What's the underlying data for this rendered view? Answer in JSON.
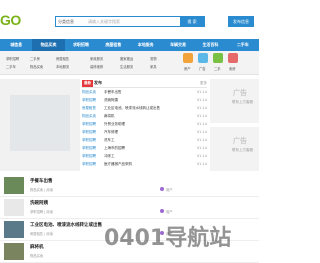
{
  "header": {
    "logo_text": "GO",
    "search": {
      "category": "分类信息",
      "placeholder": "请输入关键字搜索",
      "button": "搜 索"
    },
    "post_button": "发布信息"
  },
  "nav": [
    "城信息",
    "物品买卖",
    "求职招聘",
    "房屋租售",
    "本地服务",
    "车辆交易",
    "生活百科",
    "二手车"
  ],
  "categories": {
    "group1": [
      "求职招聘",
      "二手车",
      "二手房"
    ],
    "group2": [
      "物品买卖",
      "房屋租售",
      "本地服务"
    ],
    "group3": [
      "家政服务",
      "装修维修",
      "搬家搬运"
    ],
    "group4": [
      "生活服务",
      "宠物",
      "家具"
    ],
    "icon_labels": [
      "房产",
      "广告",
      "二手",
      "卖房"
    ]
  },
  "latest": {
    "tag_new": "最新",
    "tag_pub": "发布",
    "more": "更多",
    "rows": [
      {
        "cat": "物品买卖",
        "title": "手餐车出售",
        "date": "01-14"
      },
      {
        "cat": "求职招聘",
        "title": "洗碗阿姨",
        "date": "01-14"
      },
      {
        "cat": "房屋租售",
        "title": "工业区电池、喷漆流水线转让或出售",
        "date": "01-14"
      },
      {
        "cat": "物品买卖",
        "title": "麻将机",
        "date": "01-14"
      },
      {
        "cat": "求职招聘",
        "title": "外贸业务助理",
        "date": "01-14"
      },
      {
        "cat": "求职招聘",
        "title": "汽车修理",
        "date": "01-14"
      },
      {
        "cat": "求职招聘",
        "title": "洗车工",
        "date": "01-14"
      },
      {
        "cat": "求职招聘",
        "title": "上海市的招聘",
        "date": "01-14"
      },
      {
        "cat": "求职招聘",
        "title": "冲床工",
        "date": "01-14"
      },
      {
        "cat": "求职招聘",
        "title": "医疗器械产品采购",
        "date": "01-14"
      }
    ]
  },
  "ads": {
    "title": "广告",
    "subtitle": "联系上方客服"
  },
  "feed": [
    {
      "title": "手餐车出售",
      "meta": "物品买卖 | 阅读",
      "user": "用户"
    },
    {
      "title": "洗碗阿姨",
      "meta": "求职招聘 | 阅读",
      "user": "用户"
    },
    {
      "title": "工业区电池、喷漆流水线转让或出售",
      "meta": "房屋租售 | 阅读",
      "user": "用户"
    },
    {
      "title": "麻将机",
      "meta": "物品买卖",
      "user": ""
    }
  ],
  "overlay_text": "0401导航站"
}
